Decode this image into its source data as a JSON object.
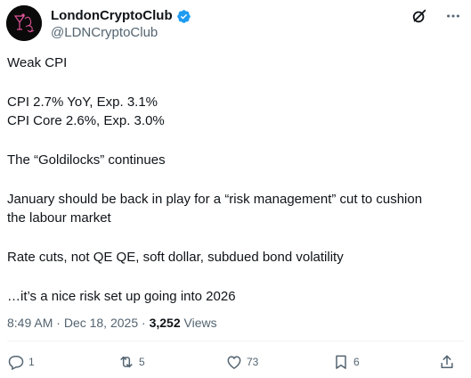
{
  "post": {
    "author_name": "LondonCryptoClub",
    "author_handle": "@LDNCryptoClub",
    "lines": [
      "Weak CPI",
      "",
      "CPI 2.7% YoY, Exp. 3.1%",
      "CPI Core 2.6%, Exp. 3.0%",
      "",
      "The “Goldilocks” continues",
      "",
      "January should be back in play for a “risk management” cut to cushion",
      "the labour market",
      "",
      "Rate cuts, not QE QE, soft dollar, subdued bond volatility",
      "",
      "…it’s a nice risk set up going into 2026"
    ],
    "time": "8:49 AM",
    "date": "Dec 18, 2025",
    "views_count": "3,252",
    "views_label": "Views"
  },
  "actions": {
    "replies": "1",
    "reposts": "5",
    "likes": "73",
    "bookmarks": "6"
  },
  "colors": {
    "text": "#0f1419",
    "muted": "#536471",
    "verified": "#1d9bf0",
    "avatar_bg": "#0a0a0a",
    "avatar_art": "#e0569b"
  },
  "icons": [
    "verified-badge-icon",
    "grok-icon",
    "more-icon",
    "reply-icon",
    "repost-icon",
    "like-icon",
    "bookmark-icon",
    "share-icon"
  ]
}
